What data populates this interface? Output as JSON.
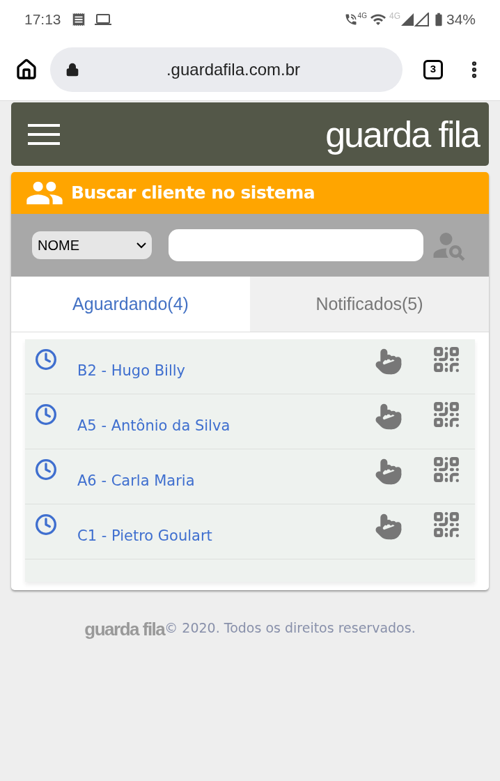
{
  "status_bar": {
    "time": "17:13",
    "call_network": "4G",
    "data_network": "4G",
    "battery": "34%"
  },
  "browser": {
    "url": ".guardafila.com.br",
    "tab_count": "3"
  },
  "header": {
    "logo": "guarda fila"
  },
  "search_panel": {
    "title": "Buscar cliente no sistema",
    "filter": "NOME"
  },
  "tabs": [
    {
      "label": "Aguardando(4)",
      "selected": true
    },
    {
      "label": "Notificados(5)",
      "selected": false
    }
  ],
  "queue": [
    {
      "label": "B2 - Hugo Billy"
    },
    {
      "label": "A5 - Antônio da Silva"
    },
    {
      "label": "A6 - Carla Maria"
    },
    {
      "label": "C1 - Pietro Goulart"
    }
  ],
  "footer": {
    "logo": "guarda fila",
    "copyright": "© 2020. Todos os direitos reservados."
  }
}
